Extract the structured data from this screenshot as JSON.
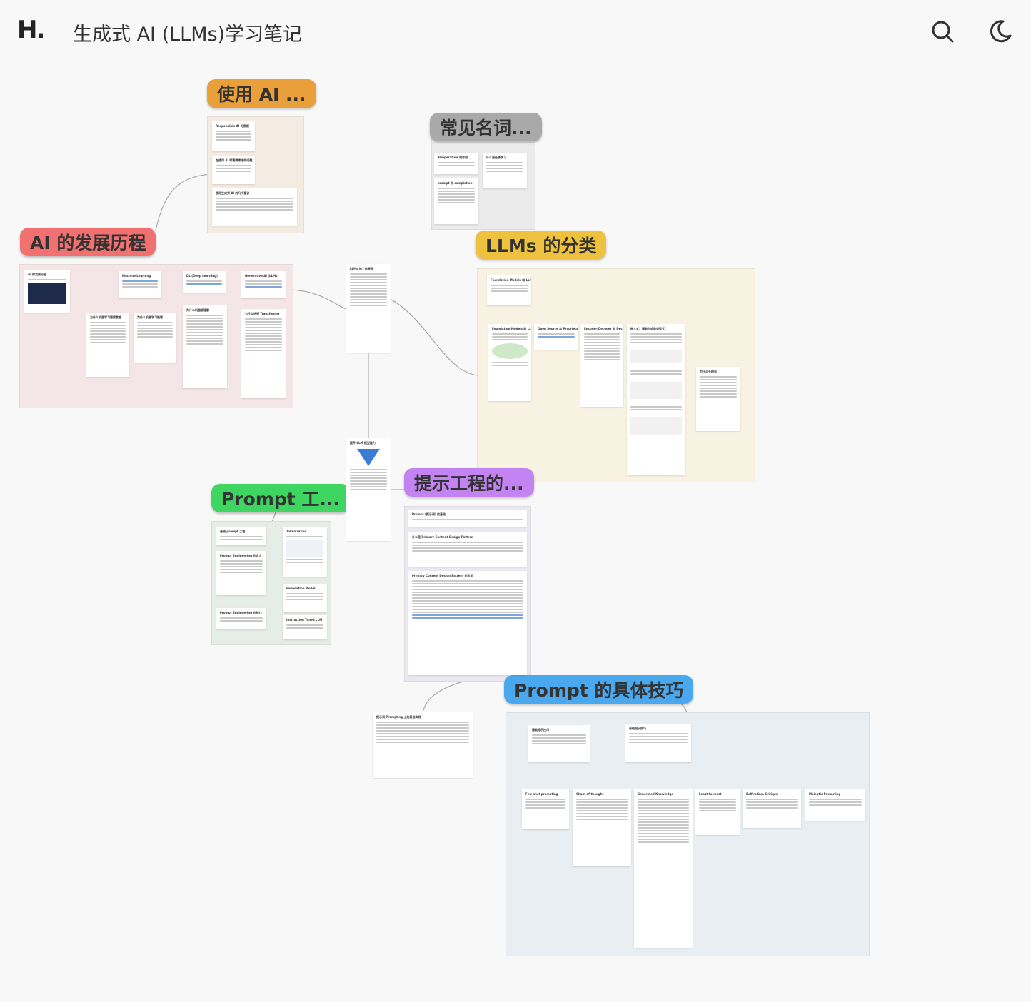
{
  "header": {
    "logo": "H.",
    "title": "生成式 AI (LLMs)学习笔记",
    "search_icon": "search-icon",
    "theme_icon": "moon-icon"
  },
  "topics": [
    {
      "id": "using-ai",
      "label": "使用 AI ...",
      "color": "#e9a03a"
    },
    {
      "id": "common-terms",
      "label": "常见名词...",
      "color": "#a9a9a9"
    },
    {
      "id": "ai-history",
      "label": "AI 的发展历程",
      "color": "#f17070"
    },
    {
      "id": "llm-types",
      "label": "LLMs 的分类",
      "color": "#eec13f"
    },
    {
      "id": "prompt-eng",
      "label": "Prompt 工...",
      "color": "#3ed660"
    },
    {
      "id": "prompt-patterns",
      "label": "提示工程的...",
      "color": "#c384f2"
    },
    {
      "id": "prompt-tips",
      "label": "Prompt 的具体技巧",
      "color": "#4aa8ef"
    }
  ],
  "cards": [
    {
      "title": "Responsible AI 的原则"
    },
    {
      "title": "在使用 AI 时需要考虑的问题"
    },
    {
      "title": "使用生成式 AI 的几个建议"
    },
    {
      "title": "Temperature 的作用"
    },
    {
      "title": "什么是迁移学习"
    },
    {
      "title": "prompt 和 completion"
    },
    {
      "title": "AI 的发展历程"
    },
    {
      "title": "Machine Learning"
    },
    {
      "title": "DL (Deep Learning)"
    },
    {
      "title": "Generative AI (LLMs)"
    },
    {
      "title": "为什么机器学习需要数据"
    },
    {
      "title": "为什么机器学习能够"
    },
    {
      "title": "为什么机器能理解"
    },
    {
      "title": "为什么选择 Transformer"
    },
    {
      "title": "LLMs 的工作原理"
    },
    {
      "title": "Foundation Models 和 LLMs"
    },
    {
      "title": "Open Source 和 Proprietary Models"
    },
    {
      "title": "Encoder-Decoder 和 Decoder-Only"
    },
    {
      "title": "嵌入式、基础生成和对话式"
    },
    {
      "title": "为什么多模态"
    },
    {
      "title": "提升 LLM 模型能力"
    },
    {
      "title": "基础 prompt 工程"
    },
    {
      "title": "Tokenization"
    },
    {
      "title": "Prompt Engineering 的定义"
    },
    {
      "title": "Foundation Model"
    },
    {
      "title": "Prompt Engineering 的核心"
    },
    {
      "title": "Instruction Tuned LLM"
    },
    {
      "title": "Prompt (提示词) 的基础"
    },
    {
      "title": "什么是 Primary Content Design Pattern"
    },
    {
      "title": "Primary Content Design Pattern 的应用"
    },
    {
      "title": "提示词 Prompting 上的最佳实践"
    },
    {
      "title": "基础提示技巧"
    },
    {
      "title": "高级提示技巧"
    },
    {
      "title": "Few-shot prompting"
    },
    {
      "title": "Chain-of-thought"
    },
    {
      "title": "Generated Knowledge"
    },
    {
      "title": "Least-to-most"
    },
    {
      "title": "Self-refine, Critique"
    },
    {
      "title": "Maieutic Prompting"
    }
  ]
}
